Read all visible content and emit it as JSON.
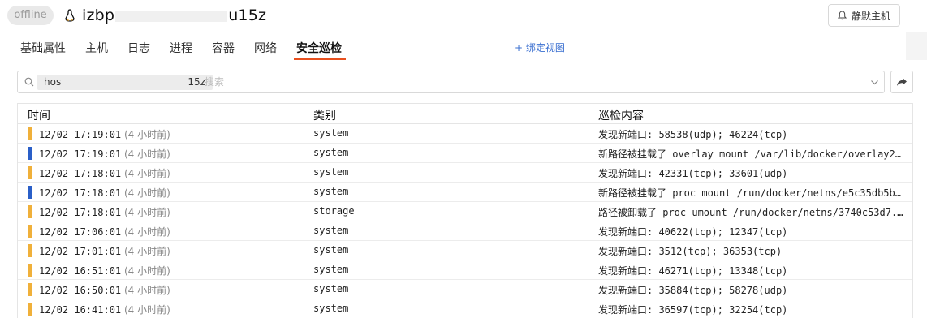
{
  "header": {
    "status": "offline",
    "host_prefix": "izbp",
    "host_suffix": "u15z",
    "mute_label": "静默主机"
  },
  "tabs": [
    {
      "label": "基础属性"
    },
    {
      "label": "主机"
    },
    {
      "label": "日志"
    },
    {
      "label": "进程"
    },
    {
      "label": "容器"
    },
    {
      "label": "网络"
    },
    {
      "label": "安全巡检",
      "active": true
    }
  ],
  "bind_view_label": "+ 绑定视图",
  "search": {
    "tag_prefix": "hos",
    "tag_suffix": "15z",
    "placeholder": "搜索"
  },
  "table": {
    "columns": [
      "时间",
      "类别",
      "巡检内容"
    ],
    "rows": [
      {
        "time": "12/02 17:19:01",
        "ago": "(4 小时前)",
        "category": "system",
        "content": "发现新端口: 58538(udp); 46224(tcp)",
        "level": "warning"
      },
      {
        "time": "12/02 17:19:01",
        "ago": "(4 小时前)",
        "category": "system",
        "content": "新路径被挂载了 overlay mount /var/lib/docker/overlay2/...",
        "level": "info"
      },
      {
        "time": "12/02 17:18:01",
        "ago": "(4 小时前)",
        "category": "system",
        "content": "发现新端口: 42331(tcp); 33601(udp)",
        "level": "warning"
      },
      {
        "time": "12/02 17:18:01",
        "ago": "(4 小时前)",
        "category": "system",
        "content": "新路径被挂载了 proc mount /run/docker/netns/e5c35db5b...",
        "level": "info"
      },
      {
        "time": "12/02 17:18:01",
        "ago": "(4 小时前)",
        "category": "storage",
        "content": "路径被卸载了 proc umount /run/docker/netns/3740c53d7...",
        "level": "warning"
      },
      {
        "time": "12/02 17:06:01",
        "ago": "(4 小时前)",
        "category": "system",
        "content": "发现新端口: 40622(tcp); 12347(tcp)",
        "level": "warning"
      },
      {
        "time": "12/02 17:01:01",
        "ago": "(4 小时前)",
        "category": "system",
        "content": "发现新端口: 3512(tcp); 36353(tcp)",
        "level": "warning"
      },
      {
        "time": "12/02 16:51:01",
        "ago": "(4 小时前)",
        "category": "system",
        "content": "发现新端口: 46271(tcp); 13348(tcp)",
        "level": "warning"
      },
      {
        "time": "12/02 16:50:01",
        "ago": "(4 小时前)",
        "category": "system",
        "content": "发现新端口: 35884(tcp); 58278(udp)",
        "level": "warning"
      },
      {
        "time": "12/02 16:41:01",
        "ago": "(4 小时前)",
        "category": "system",
        "content": "发现新端口: 36597(tcp); 32254(tcp)",
        "level": "warning"
      }
    ]
  },
  "colors": {
    "warning": "#f0b03a",
    "info": "#2a5fc8",
    "accent": "#e8501f",
    "link": "#3a6fd0"
  }
}
